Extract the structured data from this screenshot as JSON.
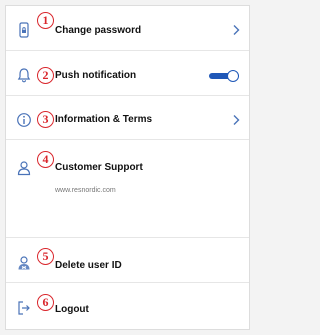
{
  "menu": {
    "items": [
      {
        "number": "1",
        "label": "Change password",
        "icon": "lock-phone-icon",
        "control": "chevron"
      },
      {
        "number": "2",
        "label": "Push notification",
        "icon": "bell-icon",
        "control": "toggle",
        "toggle_on": true
      },
      {
        "number": "3",
        "label": "Information & Terms",
        "icon": "info-icon",
        "control": "chevron"
      },
      {
        "number": "4",
        "label": "Customer Support",
        "icon": "user-icon",
        "sublabel": "www.resnordic.com"
      },
      {
        "number": "5",
        "label": "Delete user ID",
        "icon": "user-remove-icon"
      },
      {
        "number": "6",
        "label": "Logout",
        "icon": "logout-icon"
      }
    ]
  },
  "colors": {
    "badge": "#d9262c",
    "accent": "#1f58b8",
    "icon": "#4a73b8"
  }
}
